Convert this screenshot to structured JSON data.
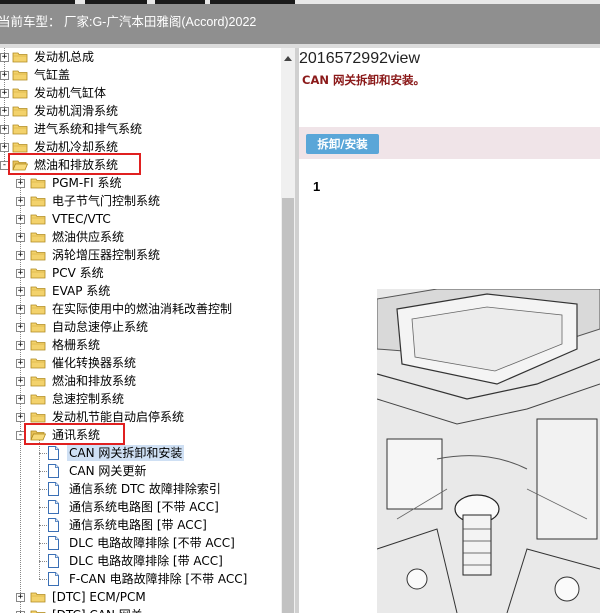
{
  "header": {
    "title": "当前车型：  厂家:G-广汽本田雅阁(Accord)2022"
  },
  "tree": {
    "items": [
      {
        "label": "发动机总成",
        "level": 0,
        "expander": "+",
        "icon": "folder-closed-icon"
      },
      {
        "label": "气缸盖",
        "level": 0,
        "expander": "+",
        "icon": "folder-closed-icon"
      },
      {
        "label": "发动机气缸体",
        "level": 0,
        "expander": "+",
        "icon": "folder-closed-icon"
      },
      {
        "label": "发动机润滑系统",
        "level": 0,
        "expander": "+",
        "icon": "folder-closed-icon"
      },
      {
        "label": "进气系统和排气系统",
        "level": 0,
        "expander": "+",
        "icon": "folder-closed-icon"
      },
      {
        "label": "发动机冷却系统",
        "level": 0,
        "expander": "+",
        "icon": "folder-closed-icon"
      },
      {
        "label": "燃油和排放系统",
        "level": 0,
        "expander": "-",
        "icon": "folder-open-icon",
        "highlight": true
      },
      {
        "label": "PGM-FI 系统",
        "level": 1,
        "expander": "+",
        "icon": "folder-closed-icon"
      },
      {
        "label": "电子节气门控制系统",
        "level": 1,
        "expander": "+",
        "icon": "folder-closed-icon"
      },
      {
        "label": "VTEC/VTC",
        "level": 1,
        "expander": "+",
        "icon": "folder-closed-icon"
      },
      {
        "label": "燃油供应系统",
        "level": 1,
        "expander": "+",
        "icon": "folder-closed-icon"
      },
      {
        "label": "涡轮增压器控制系统",
        "level": 1,
        "expander": "+",
        "icon": "folder-closed-icon"
      },
      {
        "label": "PCV 系统",
        "level": 1,
        "expander": "+",
        "icon": "folder-closed-icon"
      },
      {
        "label": "EVAP 系统",
        "level": 1,
        "expander": "+",
        "icon": "folder-closed-icon"
      },
      {
        "label": "在实际使用中的燃油消耗改善控制",
        "level": 1,
        "expander": "+",
        "icon": "folder-closed-icon"
      },
      {
        "label": "自动怠速停止系统",
        "level": 1,
        "expander": "+",
        "icon": "folder-closed-icon"
      },
      {
        "label": "格栅系统",
        "level": 1,
        "expander": "+",
        "icon": "folder-closed-icon"
      },
      {
        "label": "催化转换器系统",
        "level": 1,
        "expander": "+",
        "icon": "folder-closed-icon"
      },
      {
        "label": "燃油和排放系统",
        "level": 1,
        "expander": "+",
        "icon": "folder-closed-icon"
      },
      {
        "label": "怠速控制系统",
        "level": 1,
        "expander": "+",
        "icon": "folder-closed-icon"
      },
      {
        "label": "发动机节能自动启停系统",
        "level": 1,
        "expander": "+",
        "icon": "folder-closed-icon"
      },
      {
        "label": "通讯系统",
        "level": 1,
        "expander": "-",
        "icon": "folder-open-icon",
        "highlight": true
      },
      {
        "label": "CAN 网关拆卸和安装",
        "level": 2,
        "expander": "",
        "icon": "document-icon",
        "selected": true
      },
      {
        "label": "CAN 网关更新",
        "level": 2,
        "expander": "",
        "icon": "document-icon"
      },
      {
        "label": "通信系统 DTC 故障排除索引",
        "level": 2,
        "expander": "",
        "icon": "document-icon"
      },
      {
        "label": "通信系统电路图 [不带 ACC]",
        "level": 2,
        "expander": "",
        "icon": "document-icon"
      },
      {
        "label": "通信系统电路图 [带 ACC]",
        "level": 2,
        "expander": "",
        "icon": "document-icon"
      },
      {
        "label": "DLC 电路故障排除 [不带 ACC]",
        "level": 2,
        "expander": "",
        "icon": "document-icon"
      },
      {
        "label": "DLC 电路故障排除 [带 ACC]",
        "level": 2,
        "expander": "",
        "icon": "document-icon"
      },
      {
        "label": "F-CAN 电路故障排除 [不带 ACC]",
        "level": 2,
        "expander": "",
        "icon": "document-icon"
      },
      {
        "label": "[DTC] ECM/PCM",
        "level": 1,
        "expander": "+",
        "icon": "folder-closed-icon"
      },
      {
        "label": "[DTC] CAN 网关",
        "level": 1,
        "expander": "+",
        "icon": "folder-closed-icon"
      }
    ]
  },
  "content": {
    "doc_id": "2016572992view",
    "subtitle": "CAN 网关拆卸和安装。",
    "tab_label": "拆卸/安装",
    "step_number": "1"
  },
  "colors": {
    "header_bg": "#8f8f8f",
    "highlight_box": "#e02020",
    "tab_bg": "#5aa6d8",
    "subtitle": "#8b1a1a",
    "selected_bg": "#cfe0f4"
  }
}
